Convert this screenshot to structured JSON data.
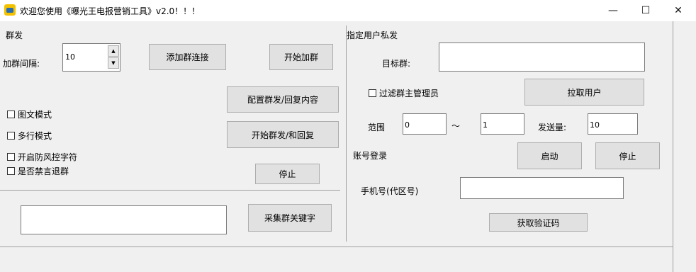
{
  "window": {
    "title": "欢迎您使用《曝光王电报营销工具》v2.0！！！",
    "minimize": "—",
    "maximize": "☐",
    "close": "✕"
  },
  "left": {
    "section_title": "群发",
    "interval_label": "加群间隔:",
    "interval_value": "10",
    "add_link_button": "添加群连接",
    "start_join_button": "开始加群",
    "config_button": "配置群发/回复内容",
    "start_mass_button": "开始群发/和回复",
    "stop_button": "停止",
    "checkbox_image_text": "图文模式",
    "checkbox_multiline": "多行模式",
    "checkbox_anti_risk": "开启防风控字符",
    "checkbox_mute_quit": "是否禁言退群",
    "keyword_value": "",
    "collect_keyword_button": "采集群关键字"
  },
  "right": {
    "section_title": "指定用户私发",
    "target_group_label": "目标群:",
    "target_group_value": "",
    "filter_admin_label": "过滤群主管理员",
    "pull_users_button": "拉取用户",
    "range_label": "范围",
    "range_from": "0",
    "range_sep": "～",
    "range_to": "1",
    "send_count_label": "发送量:",
    "send_count_value": "10",
    "account_login_label": "账号登录",
    "start_button": "启动",
    "stop_button": "停止",
    "phone_label": "手机号(代区号)",
    "phone_value": "",
    "get_code_button": "获取验证码"
  }
}
